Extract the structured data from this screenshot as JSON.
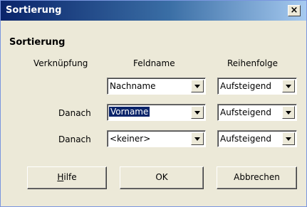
{
  "window": {
    "title": "Sortierung",
    "close_glyph": "×"
  },
  "group": {
    "title": "Sortierung"
  },
  "headers": {
    "link": "Verknüpfung",
    "field": "Feldname",
    "order": "Reihenfolge"
  },
  "rows": [
    {
      "link": "",
      "field": "Nachname",
      "order": "Aufsteigend"
    },
    {
      "link": "Danach",
      "field": "Vorname",
      "order": "Aufsteigend"
    },
    {
      "link": "Danach",
      "field": "<keiner>",
      "order": "Aufsteigend"
    }
  ],
  "buttons": {
    "help_mnemonic": "H",
    "help_rest": "ilfe",
    "ok": "OK",
    "cancel": "Abbrechen"
  }
}
